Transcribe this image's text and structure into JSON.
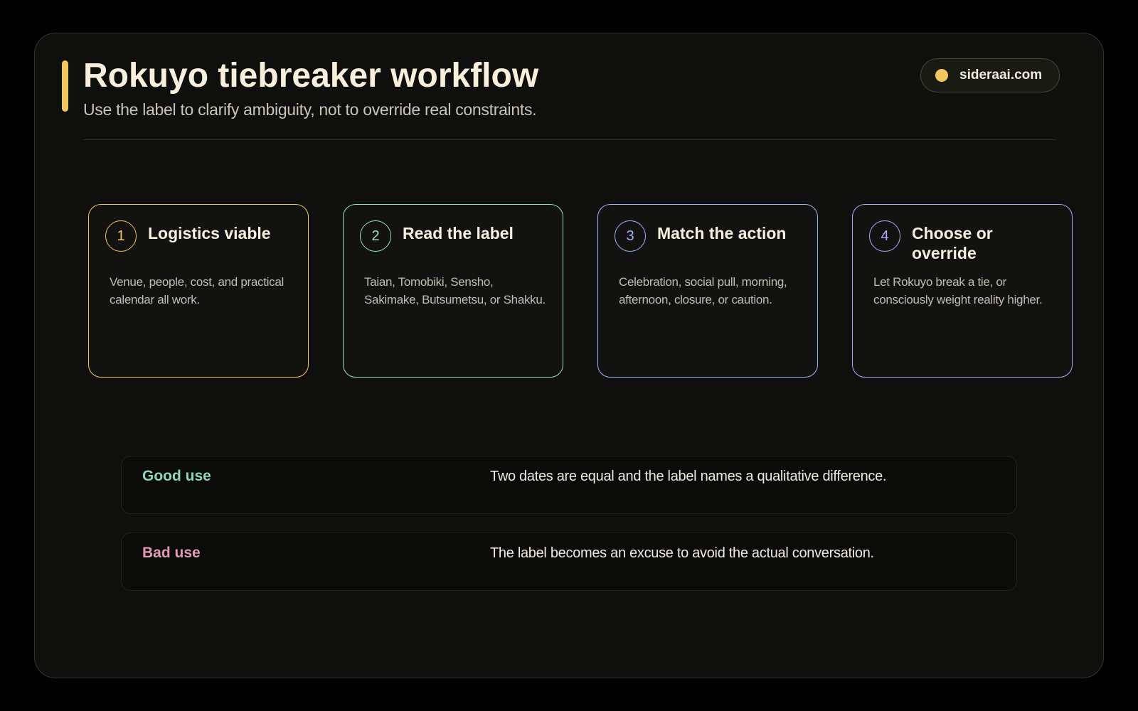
{
  "header": {
    "title": "Rokuyo tiebreaker workflow",
    "subtitle": "Use the label to clarify ambiguity, not to override real constraints.",
    "site": "sideraai.com"
  },
  "colors": {
    "accent": "#f2c75c",
    "step1": "#f2c75c",
    "step2": "#8fe3c0",
    "step3": "#9fb3f5",
    "step4": "#b7a5f5",
    "good": "#8ed7bd",
    "bad": "#e39ab5"
  },
  "steps": [
    {
      "number": "1",
      "title": "Logistics viable",
      "desc": "Venue, people, cost, and practical calendar all work."
    },
    {
      "number": "2",
      "title": "Read the label",
      "desc": "Taian, Tomobiki, Sensho, Sakimake, Butsumetsu, or Shakku."
    },
    {
      "number": "3",
      "title": "Match the action",
      "desc": "Celebration, social pull, morning, afternoon, closure, or caution."
    },
    {
      "number": "4",
      "title": "Choose or override",
      "desc": "Let Rokuyo break a tie, or consciously weight reality higher."
    }
  ],
  "uses": {
    "good": {
      "label": "Good use",
      "text": "Two dates are equal and the label names a qualitative difference."
    },
    "bad": {
      "label": "Bad use",
      "text": "The label becomes an excuse to avoid the actual conversation."
    }
  }
}
